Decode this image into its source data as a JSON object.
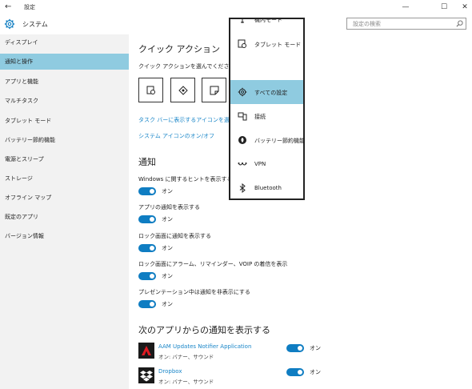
{
  "window": {
    "title": "設定",
    "back_glyph": "←",
    "minimize_glyph": "—",
    "maximize_glyph": "☐",
    "close_glyph": "✕"
  },
  "header": {
    "app_title": "システム",
    "search_placeholder": "設定の検索",
    "accent_color": "#0f7dc2"
  },
  "sidebar": {
    "items": [
      {
        "label": "ディスプレイ"
      },
      {
        "label": "通知と操作",
        "selected": true
      },
      {
        "label": "アプリと機能"
      },
      {
        "label": "マルチタスク"
      },
      {
        "label": "タブレット モード"
      },
      {
        "label": "バッテリー節約機能"
      },
      {
        "label": "電源とスリープ"
      },
      {
        "label": "ストレージ"
      },
      {
        "label": "オフライン マップ"
      },
      {
        "label": "既定のアプリ"
      },
      {
        "label": "バージョン情報"
      }
    ]
  },
  "quick_actions": {
    "heading": "クイック アクション",
    "subheading": "クイック アクションを選んでください",
    "tiles": [
      {
        "icon": "tablet-mode-icon"
      },
      {
        "icon": "location-icon"
      },
      {
        "icon": "note-icon"
      }
    ],
    "links": [
      "タスク バーに表示するアイコンを選択して",
      "システム アイコンのオン/オフ"
    ]
  },
  "notifications": {
    "heading": "通知",
    "settings": [
      {
        "label": "Windows に関するヒントを表示する",
        "state": "オン"
      },
      {
        "label": "アプリの通知を表示する",
        "state": "オン"
      },
      {
        "label": "ロック画面に通知を表示する",
        "state": "オン"
      },
      {
        "label": "ロック画面にアラーム、リマインダー、VOIP の着信を表示",
        "state": "オン"
      },
      {
        "label": "プレゼンテーション中は通知を非表示にする",
        "state": "オン"
      }
    ]
  },
  "apps_section": {
    "heading": "次のアプリからの通知を表示する",
    "apps": [
      {
        "name": "AAM Updates Notifier Application",
        "detail": "オン: バナー、サウンド",
        "state": "オン"
      },
      {
        "name": "Dropbox",
        "detail": "オン: バナー、サウンド",
        "state": "オン"
      }
    ]
  },
  "popup": {
    "items": [
      {
        "label": "機内モード",
        "icon": "airplane-icon"
      },
      {
        "label": "タブレット モード",
        "icon": "tablet-mode-icon"
      },
      {
        "label": "",
        "icon": ""
      },
      {
        "label": "すべての設定",
        "icon": "gear-icon",
        "selected": true
      },
      {
        "label": "接続",
        "icon": "connect-icon"
      },
      {
        "label": "バッテリー節約機能",
        "icon": "battery-saver-icon"
      },
      {
        "label": "VPN",
        "icon": "vpn-icon"
      },
      {
        "label": "Bluetooth",
        "icon": "bluetooth-icon"
      }
    ]
  }
}
